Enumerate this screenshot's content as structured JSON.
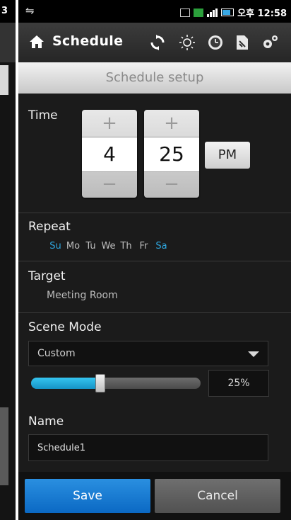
{
  "left_panel": {
    "clock_fragment": "3"
  },
  "status_bar": {
    "time": "오후 12:58"
  },
  "action_bar": {
    "title": "Schedule",
    "icons": [
      "home-icon",
      "sync-icon",
      "brightness-icon",
      "clock-icon",
      "document-icon",
      "settings-icon"
    ]
  },
  "subheader": "Schedule setup",
  "time": {
    "label": "Time",
    "hour": "4",
    "minute": "25",
    "ampm": "PM",
    "plus": "+",
    "minus": "−"
  },
  "repeat": {
    "label": "Repeat",
    "days": [
      {
        "label": "Su",
        "selected": true
      },
      {
        "label": "Mo",
        "selected": false
      },
      {
        "label": "Tu",
        "selected": false
      },
      {
        "label": "We",
        "selected": false
      },
      {
        "label": "Th",
        "selected": false
      },
      {
        "label": "Fr",
        "selected": false
      },
      {
        "label": "Sa",
        "selected": true
      }
    ]
  },
  "target": {
    "label": "Target",
    "value": "Meeting Room"
  },
  "scene_mode": {
    "label": "Scene Mode",
    "selected": "Custom",
    "level_percent": 25,
    "level_text": "25%"
  },
  "name": {
    "label": "Name",
    "value": "Schedule1"
  },
  "buttons": {
    "save": "Save",
    "cancel": "Cancel"
  },
  "colors": {
    "accent": "#2ea7e0",
    "save": "#1a7fd6",
    "background": "#1b1b1b"
  }
}
